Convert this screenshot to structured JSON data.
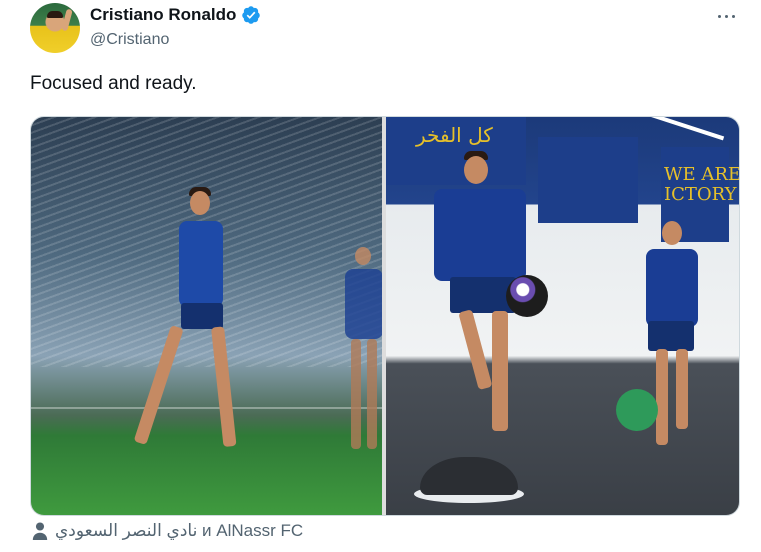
{
  "author": {
    "name": "Cristiano Ronaldo",
    "handle": "@Cristiano",
    "verified": true,
    "verified_color": "#1d9bf0"
  },
  "tweet": {
    "text": "Focused and ready."
  },
  "media": {
    "images": [
      {
        "alt": "Cristiano Ronaldo training on grass pitch with sprinklers"
      },
      {
        "alt": "Cristiano Ronaldo balancing on a bosu ball in the gym"
      }
    ],
    "gym_banner_text": "كل الفخر",
    "gym_wall_text": "WE ARE\nICTORY"
  },
  "tagged": {
    "icon": "person-icon",
    "text": "نادي النصر السعودي и AlNassr FC"
  },
  "colors": {
    "text_primary": "#0f1419",
    "text_secondary": "#536471",
    "border": "#cfd9de"
  }
}
